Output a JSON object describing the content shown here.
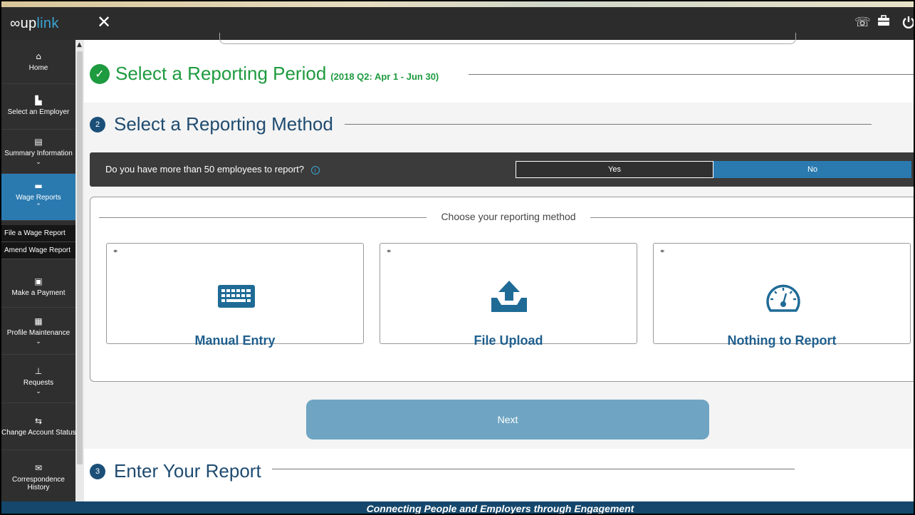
{
  "header": {
    "logo_prefix": "∞",
    "logo_up": "up",
    "logo_link": "link",
    "close_icon": "close-icon",
    "icons": [
      "phone-icon",
      "briefcase-icon",
      "power-icon"
    ]
  },
  "sidebar": {
    "items": [
      {
        "label": "Home",
        "icon": "home-icon"
      },
      {
        "label": "Select an Employer",
        "icon": "building-icon"
      },
      {
        "label": "Summary Information",
        "icon": "document-icon"
      },
      {
        "label": "Wage Reports",
        "icon": "folder-icon"
      },
      {
        "label": "Make a Payment",
        "icon": "money-icon"
      },
      {
        "label": "Profile Maintenance",
        "icon": "clipboard-icon"
      },
      {
        "label": "Requests",
        "icon": "hand-truck-icon"
      },
      {
        "label": "Change Account Status",
        "icon": "exchange-icon"
      },
      {
        "label": "Correspondence History",
        "icon": "envelope-icon"
      }
    ],
    "sub_items": [
      {
        "label": "File a Wage Report"
      },
      {
        "label": "Amend Wage Report"
      }
    ]
  },
  "steps": {
    "step1": {
      "title": "Select a Reporting Period",
      "detail": "(2018 Q2: Apr 1 - Jun 30)"
    },
    "step2": {
      "number": "2",
      "title": "Select a Reporting Method"
    },
    "step3": {
      "number": "3",
      "title": "Enter Your Report"
    }
  },
  "question": {
    "text": "Do you have more than 50 employees to report?",
    "info": "i",
    "yes_label": "Yes",
    "no_label": "No",
    "selected": "No"
  },
  "methods": {
    "heading": "Choose your reporting method",
    "cards": [
      {
        "label": "Manual Entry",
        "icon": "keyboard-icon"
      },
      {
        "label": "File Upload",
        "icon": "upload-icon"
      },
      {
        "label": "Nothing to Report",
        "icon": "gauge-icon"
      }
    ]
  },
  "next_label": "Next",
  "footer": {
    "tagline": "Connecting People and Employers through Engagement"
  },
  "colors": {
    "accent": "#2a7ab0",
    "success": "#1e9a3f",
    "title": "#1f4b70",
    "footer": "#14476b"
  }
}
